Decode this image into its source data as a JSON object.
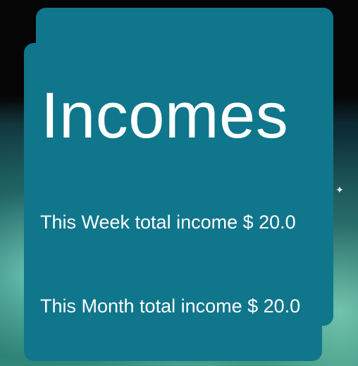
{
  "screen": {
    "title": "Incomes",
    "week_income_label": "This Week total income $ 20.0",
    "month_income_label": "This Month total income $ 20.0"
  },
  "colors": {
    "card": "#0f768c",
    "text": "#ffffff",
    "wallpaper_top": "#050505",
    "wallpaper_bottom": "#3b9a86"
  },
  "icons": {
    "sparkle": "✦"
  }
}
